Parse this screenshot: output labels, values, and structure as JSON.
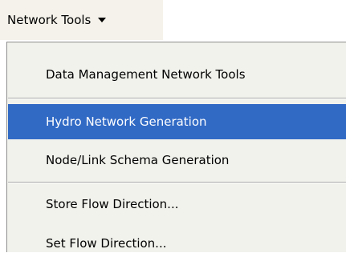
{
  "toolbar": {
    "label": "Network Tools",
    "dropdown_icon": "caret-down-icon"
  },
  "menu": {
    "items": [
      {
        "label": "Data Management Network Tools"
      },
      {
        "label": "Hydro Network Generation",
        "highlighted": true
      },
      {
        "label": "Node/Link Schema Generation"
      },
      {
        "label": "Store Flow Direction..."
      },
      {
        "label": "Set Flow Direction..."
      }
    ]
  },
  "colors": {
    "highlight": "#316ac5",
    "menu_background": "#f2f2ed",
    "toolbar_background": "#f4f2ea",
    "separator": "#a9a9a9"
  }
}
